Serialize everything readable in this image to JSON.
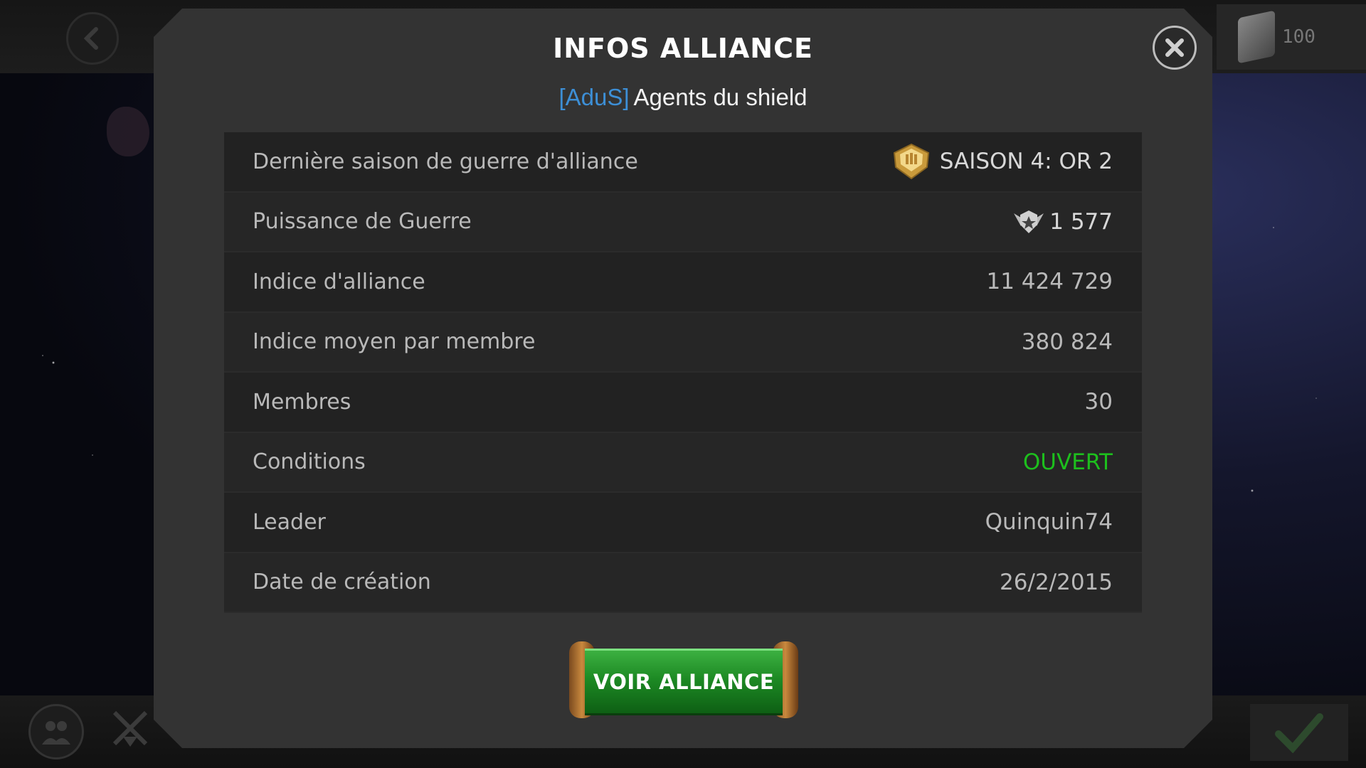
{
  "top_bar": {
    "token_count": "100"
  },
  "modal": {
    "title": "INFOS ALLIANCE",
    "alliance_tag": "[AduS]",
    "alliance_name": "Agents du shield"
  },
  "rows": [
    {
      "label": "Dernière saison de guerre d'alliance",
      "value": "SAISON 4: OR 2",
      "icon": "gold-season-badge-icon"
    },
    {
      "label": "Puissance de Guerre",
      "value": "1 577",
      "icon": "war-rating-emblem-icon"
    },
    {
      "label": "Indice d'alliance",
      "value": "11 424 729"
    },
    {
      "label": "Indice moyen par membre",
      "value": "380 824"
    },
    {
      "label": "Membres",
      "value": "30"
    },
    {
      "label": "Conditions",
      "value": "OUVERT",
      "value_color": "#1dbf1d"
    },
    {
      "label": "Leader",
      "value": "Quinquin74"
    },
    {
      "label": "Date de création",
      "value": "26/2/2015"
    }
  ],
  "cta": {
    "label": "VOIR ALLIANCE"
  },
  "colors": {
    "tag_blue": "#3d8fd6",
    "open_green": "#1dbf1d",
    "button_green": "#1d8a24"
  }
}
